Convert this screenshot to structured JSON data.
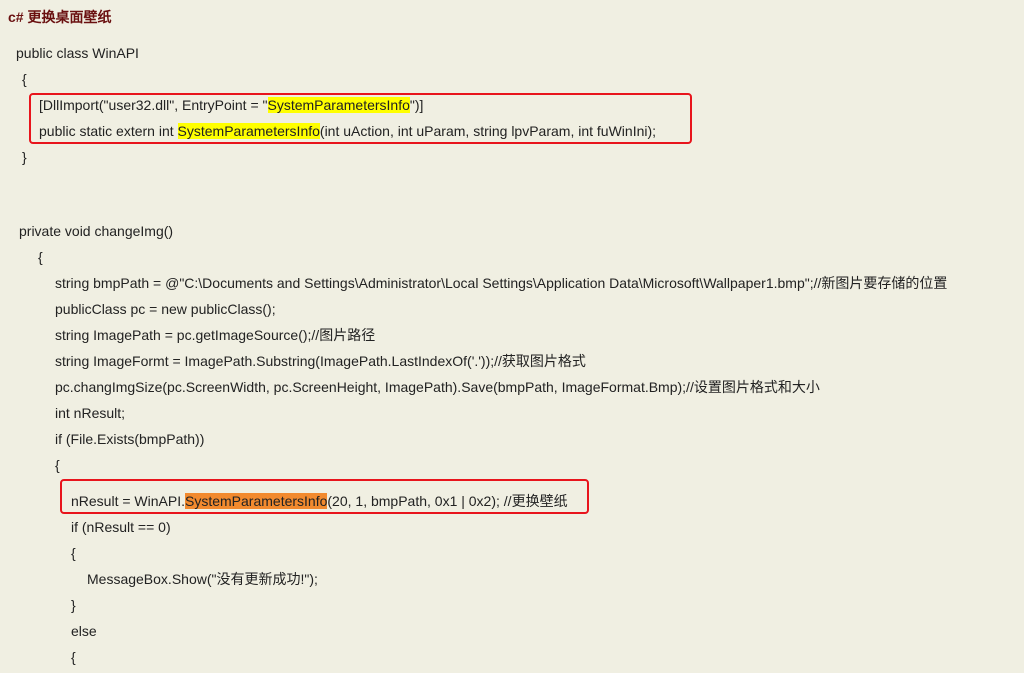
{
  "title": "c# 更换桌面壁纸",
  "colors": {
    "background": "#f0efe2",
    "title": "#6a1010",
    "highlight_yellow": "#ffff00",
    "highlight_orange": "#f28a2e",
    "annotation_box": "#e8141c"
  },
  "code": {
    "class_decl": "public class WinAPI",
    "open_brace_1": "{",
    "dllimport_pre": "[DllImport(\"user32.dll\", EntryPoint = \"",
    "dllimport_hl": "SystemParametersInfo",
    "dllimport_post": "\")]",
    "extern_pre": "public static extern int ",
    "extern_hl": "SystemParametersInfo",
    "extern_post": "(int uAction, int uParam, string lpvParam, int fuWinIni);",
    "close_brace_1": "}",
    "method_decl": "private void changeImg()",
    "open_brace_2": "{",
    "line_bmppath": "string bmpPath = @\"C:\\Documents and Settings\\Administrator\\Local Settings\\Application Data\\Microsoft\\Wallpaper1.bmp\";//新图片要存储的位置",
    "line_pc": "publicClass pc = new publicClass();",
    "line_imagepath": "string ImagePath = pc.getImageSource();//图片路径",
    "line_imageformt": "string ImageFormt = ImagePath.Substring(ImagePath.LastIndexOf('.'));//获取图片格式",
    "line_changsize": "pc.changImgSize(pc.ScreenWidth, pc.ScreenHeight, ImagePath).Save(bmpPath, ImageFormat.Bmp);//设置图片格式和大小",
    "line_nresult_decl": "int nResult;",
    "line_if_exists": "if (File.Exists(bmpPath))",
    "open_brace_3": "{",
    "call_pre": "nResult = WinAPI.",
    "call_hl": "SystemParametersInfo",
    "call_post": "(20, 1, bmpPath, 0x1 | 0x2); //更换壁纸",
    "line_if_zero": "if (nResult == 0)",
    "open_brace_4": "{",
    "line_messagebox": "MessageBox.Show(\"没有更新成功!\");",
    "close_brace_4": "}",
    "line_else": "else",
    "open_brace_5": "{"
  }
}
